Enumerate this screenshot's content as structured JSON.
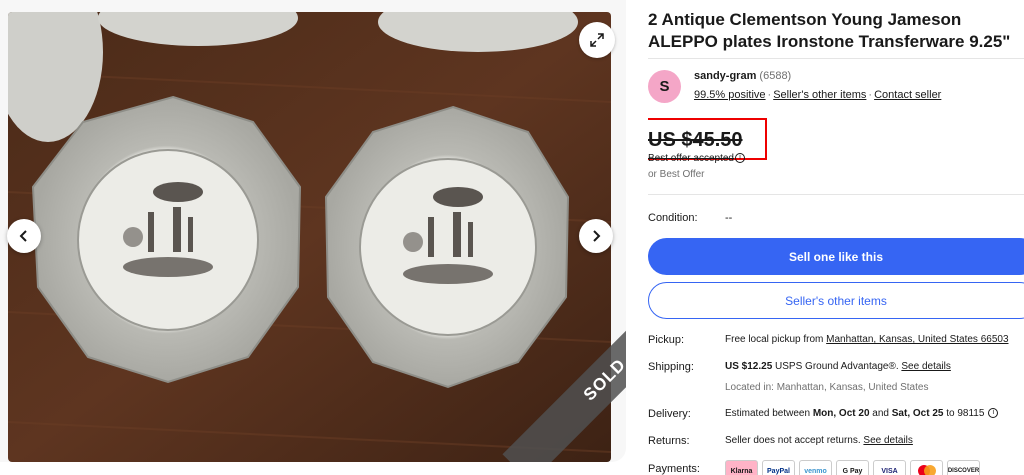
{
  "listing": {
    "title": "2 Antique Clementson Young Jameson ALEPPO plates Ironstone Transferware 9.25\"",
    "sold_label": "SOLD"
  },
  "gallery": {
    "expand_icon": "expand-icon",
    "prev_icon": "chevron-left-icon",
    "next_icon": "chevron-right-icon"
  },
  "seller": {
    "avatar_letter": "S",
    "name": "sandy-gram",
    "feedback_count": "(6588)",
    "positive": "99.5% positive",
    "other_items_link": "Seller's other items",
    "contact_link": "Contact seller",
    "avatar_color": "#f4a6c7"
  },
  "price": {
    "amount": "US $45.50",
    "best_offer_accepted": "Best offer accepted",
    "or_best_offer": "or Best Offer"
  },
  "condition": {
    "label": "Condition:",
    "value": "--"
  },
  "buttons": {
    "sell_one_like_this": "Sell one like this",
    "sellers_other_items": "Seller's other items",
    "primary_color": "#3665f3"
  },
  "details": {
    "pickup_label": "Pickup:",
    "pickup_text": "Free local pickup from ",
    "pickup_link": "Manhattan, Kansas, United States 66503",
    "shipping_label": "Shipping:",
    "shipping_cost": "US $12.25",
    "shipping_service": " USPS Ground Advantage®. ",
    "shipping_link": "See details",
    "shipping_location": "Located in: Manhattan, Kansas, United States",
    "delivery_label": "Delivery:",
    "delivery_prefix": "Estimated between ",
    "delivery_start": "Mon, Oct 20",
    "delivery_and": " and ",
    "delivery_end": "Sat, Oct 25",
    "delivery_suffix": " to 98115",
    "returns_label": "Returns:",
    "returns_text": "Seller does not accept returns. ",
    "returns_link": "See details",
    "payments_label": "Payments:",
    "payment_methods": [
      "Klarna",
      "PayPal",
      "venmo",
      "G Pay",
      "VISA",
      "",
      "DISCOVER",
      ""
    ]
  }
}
